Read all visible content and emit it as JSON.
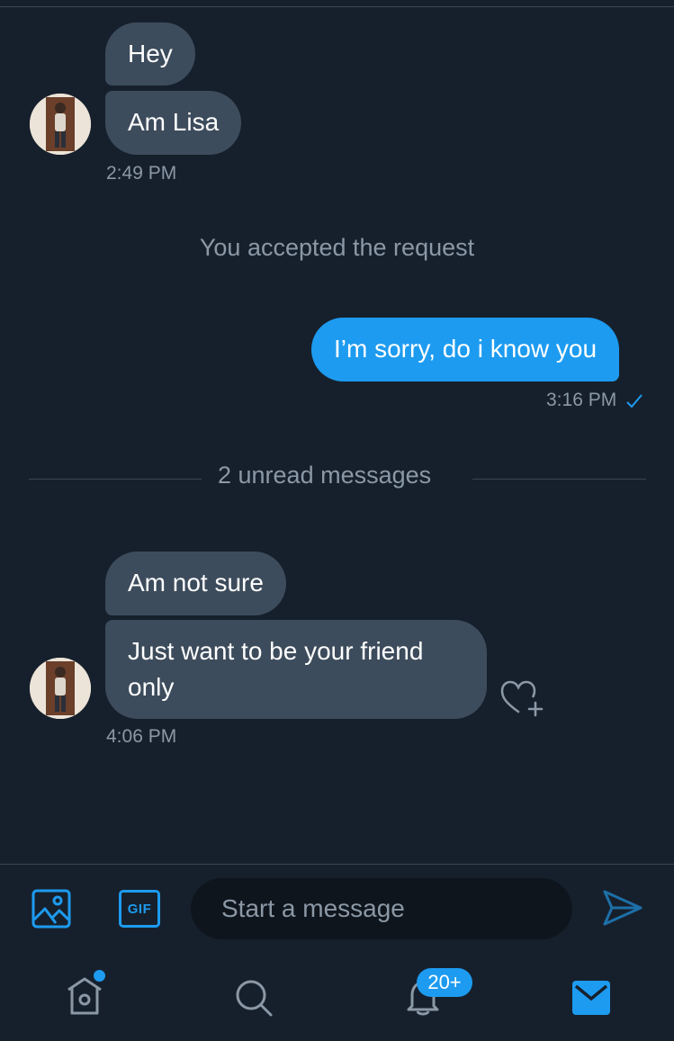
{
  "conversation": {
    "group1": {
      "messages": [
        "Hey",
        "Am Lisa"
      ],
      "time": "2:49 PM"
    },
    "system_note": "You accepted the request",
    "outgoing": {
      "text": "I’m sorry, do i know you",
      "time": "3:16 PM",
      "status_icon": "check-icon"
    },
    "unread_divider": "2 unread messages",
    "group2": {
      "messages": [
        "Am not sure",
        "Just want to be your friend",
        "only"
      ],
      "time": "4:06 PM"
    }
  },
  "composer": {
    "placeholder": "Start a message",
    "icons": [
      "image-icon",
      "gif-icon",
      "send-icon"
    ],
    "gif_label": "GIF"
  },
  "tab_bar": {
    "tabs": [
      "home-icon",
      "search-icon",
      "notifications-icon",
      "messages-icon"
    ],
    "notifications_badge": "20+",
    "accent": "#1d9bf0"
  },
  "colors": {
    "background": "#16202c",
    "incoming_bubble": "#3d4c5c",
    "outgoing_bubble": "#1d9bf0",
    "muted_text": "#8b98a5"
  }
}
